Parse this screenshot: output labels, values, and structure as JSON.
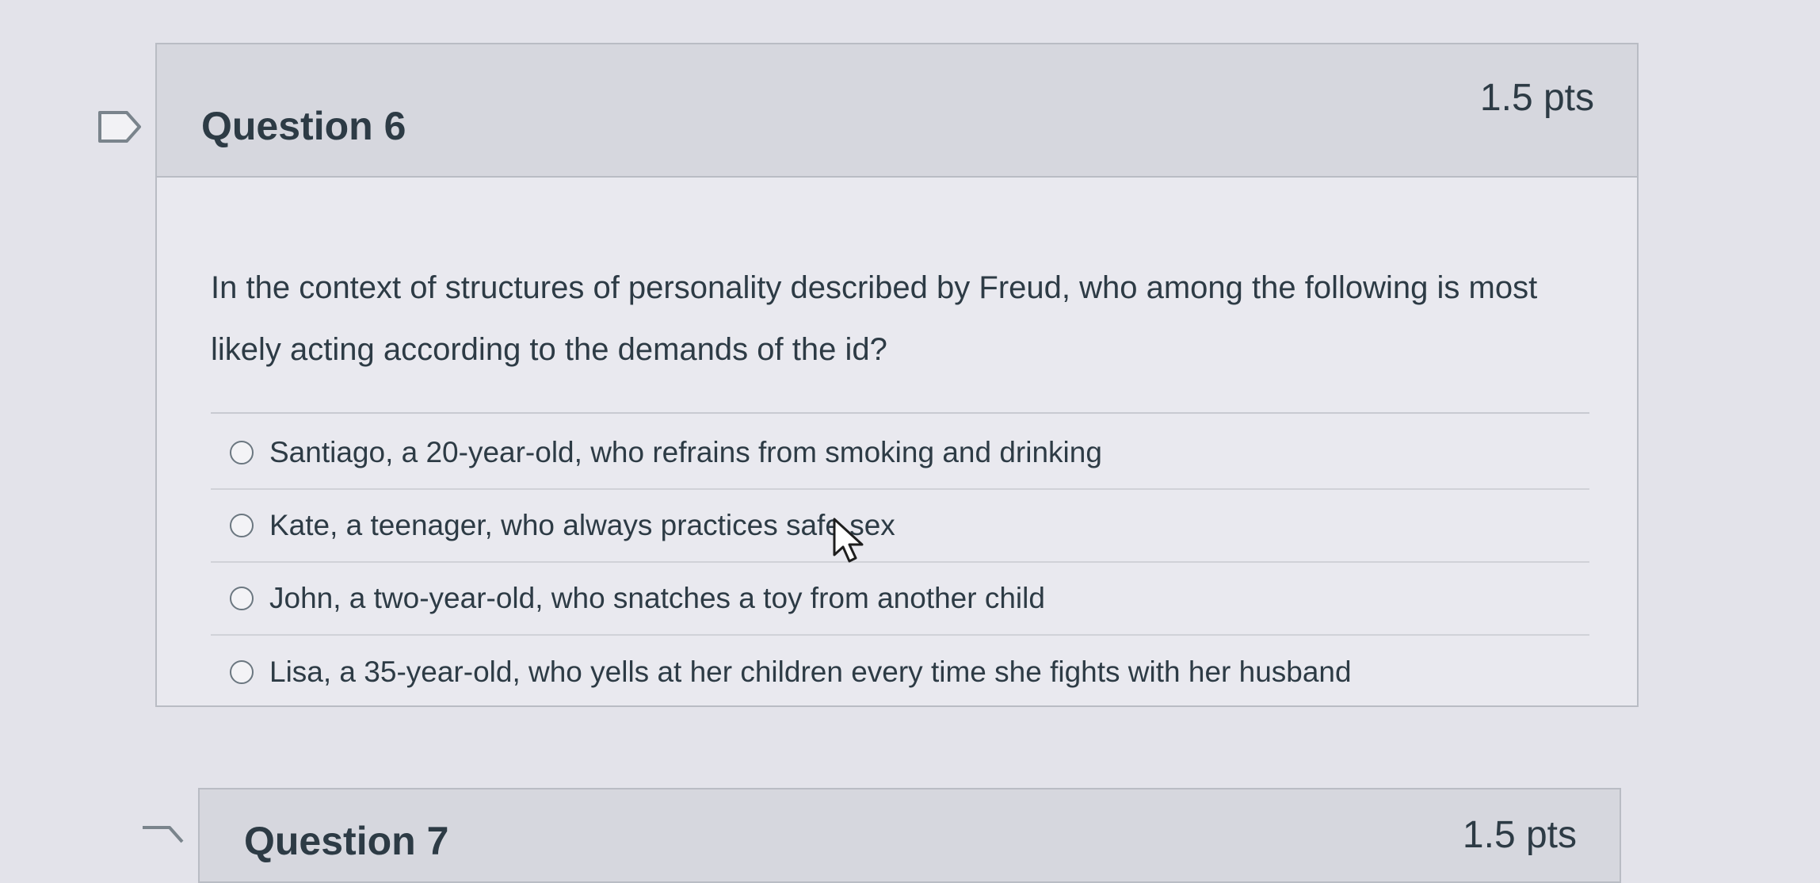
{
  "question": {
    "title": "Question 6",
    "points": "1.5 pts",
    "text": "In the context of structures of personality described by Freud, who among the following is most likely acting according to the demands of the id?",
    "answers": [
      {
        "label": "Santiago, a 20-year-old, who refrains from smoking and drinking"
      },
      {
        "label": "Kate, a teenager, who always practices safe sex"
      },
      {
        "label": "John, a two-year-old, who snatches a toy from another child"
      },
      {
        "label": "Lisa, a 35-year-old, who yells at her children every time she fights with her husband"
      }
    ]
  },
  "next_question": {
    "title": "Question 7",
    "points": "1.5 pts"
  },
  "colors": {
    "background": "#e3e3ea",
    "header_background": "#d6d7de",
    "text": "#2d3b45",
    "border": "#b9bcc4"
  },
  "icons": {
    "flag": "flag-outline-icon",
    "cursor": "mouse-pointer-icon",
    "radio": "radio-unselected-icon"
  }
}
